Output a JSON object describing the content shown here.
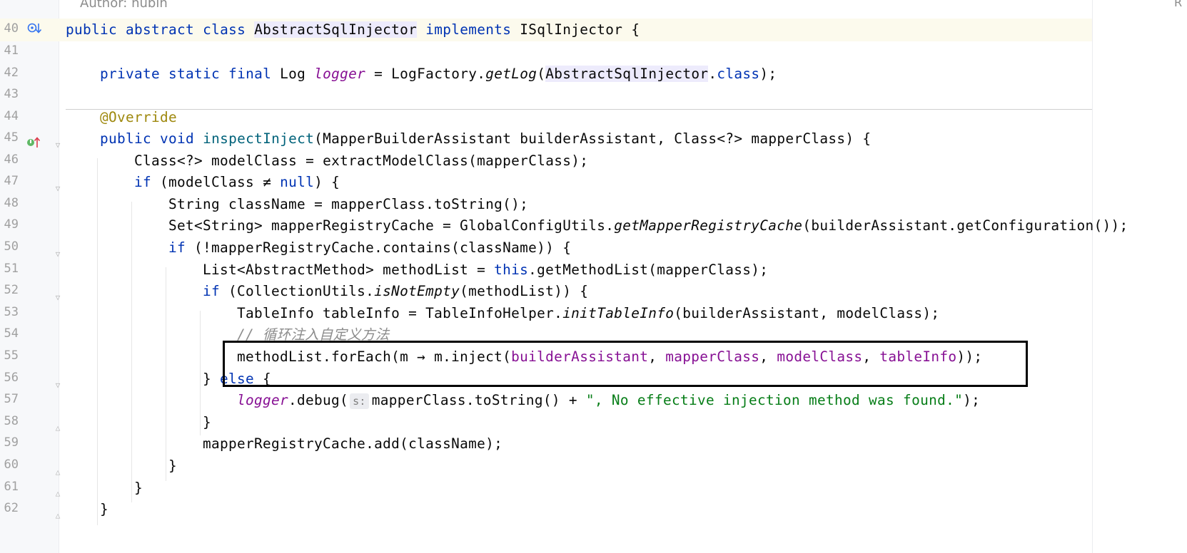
{
  "header": {
    "doc_comment": "Author: hubin",
    "corner_char": "R"
  },
  "line_numbers": [
    "40",
    "41",
    "42",
    "43",
    "44",
    "45",
    "46",
    "47",
    "48",
    "49",
    "50",
    "51",
    "52",
    "53",
    "54",
    "55",
    "56",
    "57",
    "58",
    "59",
    "60",
    "61",
    "62"
  ],
  "gutter_icons": {
    "line_40": "implementing-classes-icon",
    "line_45": "overriding-method-icon"
  },
  "code": {
    "l40": {
      "kw1": "public abstract class ",
      "class_name": "AbstractSqlInjector",
      "kw2": " implements ",
      "iface": "ISqlInjector",
      "brace": " {"
    },
    "l42": {
      "kw": "private static final ",
      "type": "Log ",
      "field": "logger",
      "eq": " = LogFactory.",
      "method": "getLog",
      "open": "(",
      "arg": "AbstractSqlInjector",
      "dot": ".",
      "kwclass": "class",
      "close": ");"
    },
    "l44": {
      "annotation": "@Override"
    },
    "l45": {
      "kw": "public void ",
      "method": "inspectInject",
      "rest": "(MapperBuilderAssistant builderAssistant, Class<?> mapperClass) {"
    },
    "l46": {
      "text": "Class<?> modelClass = extractModelClass(mapperClass);"
    },
    "l47": {
      "kw": "if ",
      "rest1": "(modelClass ",
      "neq": "≠",
      "rest2": " ",
      "kwnull": "null",
      "rest3": ") {"
    },
    "l48": {
      "text": "String className = mapperClass.toString();"
    },
    "l49": {
      "pre": "Set<String> mapperRegistryCache = GlobalConfigUtils.",
      "method": "getMapperRegistryCache",
      "post": "(builderAssistant.getConfiguration());"
    },
    "l50": {
      "kw": "if ",
      "rest": "(!mapperRegistryCache.contains(className)) {"
    },
    "l51": {
      "pre": "List<AbstractMethod> methodList = ",
      "kwthis": "this",
      "post": ".getMethodList(mapperClass);"
    },
    "l52": {
      "kw": "if ",
      "pre": "(CollectionUtils.",
      "method": "isNotEmpty",
      "post": "(methodList)) {"
    },
    "l53": {
      "pre": "TableInfo tableInfo = TableInfoHelper.",
      "method": "initTableInfo",
      "post": "(builderAssistant, modelClass);"
    },
    "l54": {
      "comment": "// 循环注入自定义方法"
    },
    "l55": {
      "pre": "methodList.forEach(m ",
      "arrow": "→",
      "mid": " m.inject(",
      "p1": "builderAssistant",
      "c1": ", ",
      "p2": "mapperClass",
      "c2": ", ",
      "p3": "modelClass",
      "c3": ", ",
      "p4": "tableInfo",
      "post": "));"
    },
    "l56": {
      "brace": "} ",
      "kw": "else",
      "post": " {"
    },
    "l57": {
      "field": "logger",
      "mid": ".debug(",
      "hint": "s:",
      "pre2": "mapperClass.toString() + ",
      "str": "\", No effective injection method was found.\"",
      "post": ");"
    },
    "l58": {
      "brace": "}"
    },
    "l59": {
      "text": "mapperRegistryCache.add(className);"
    },
    "l60": {
      "brace": "}"
    },
    "l61": {
      "brace": "}"
    },
    "l62": {
      "brace": "}"
    }
  },
  "colors": {
    "keyword": "#0033b3",
    "field": "#871094",
    "method_decl": "#00627a",
    "annotation": "#9e880d",
    "string": "#067d17",
    "comment": "#8c8c8c",
    "highlight_box": "#000000"
  }
}
